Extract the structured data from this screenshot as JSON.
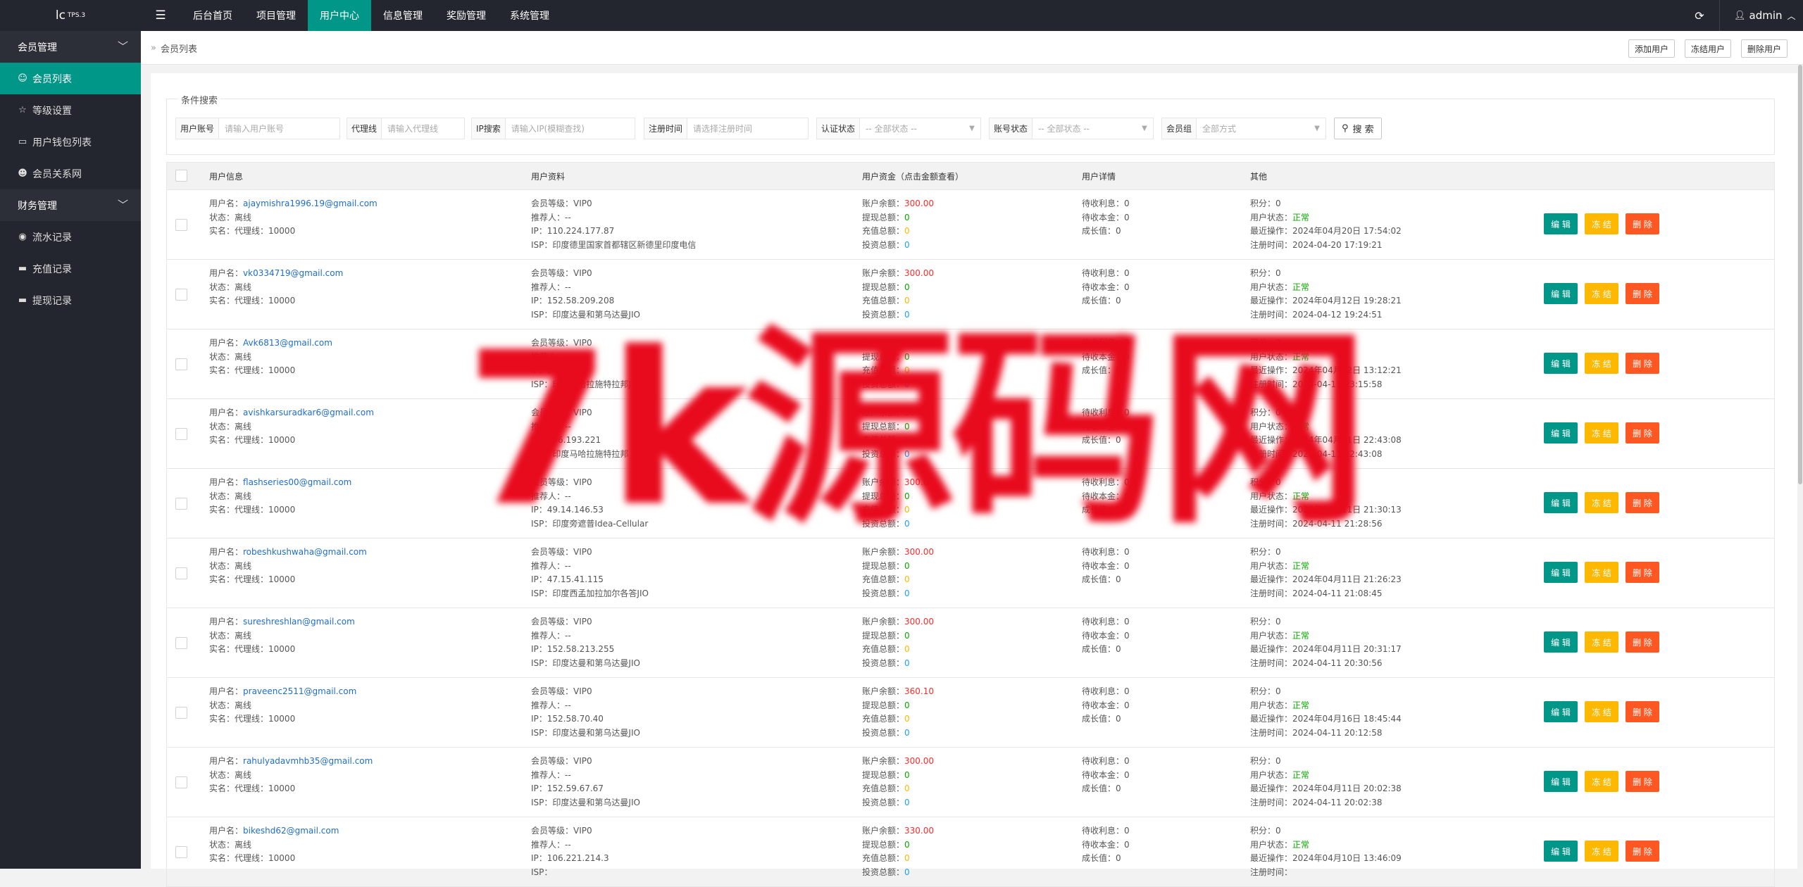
{
  "app": {
    "logo": "lc",
    "version": "TPS.3"
  },
  "top_nav": [
    "后台首页",
    "项目管理",
    "用户中心",
    "信息管理",
    "奖励管理",
    "系统管理"
  ],
  "top_nav_active": "用户中心",
  "user_menu": {
    "name": "admin"
  },
  "sidebar": {
    "groups": [
      {
        "label": "会员管理",
        "items": [
          {
            "label": "会员列表",
            "icon": "user-icon",
            "active": true
          },
          {
            "label": "等级设置",
            "icon": "star-icon"
          },
          {
            "label": "用户钱包列表",
            "icon": "wallet-icon"
          },
          {
            "label": "会员关系网",
            "icon": "users-icon"
          }
        ]
      },
      {
        "label": "财务管理",
        "items": [
          {
            "label": "流水记录",
            "icon": "record-icon"
          },
          {
            "label": "充值记录",
            "icon": "card-icon"
          },
          {
            "label": "提现记录",
            "icon": "card-icon"
          }
        ]
      }
    ]
  },
  "breadcrumb": {
    "separator": "»",
    "current": "会员列表"
  },
  "top_buttons": {
    "add": "添加用户",
    "freeze": "冻结用户",
    "delete": "删除用户"
  },
  "filters": {
    "legend": "条件搜索",
    "account": {
      "label": "用户账号",
      "placeholder": "请输入用户账号"
    },
    "agent": {
      "label": "代理线",
      "placeholder": "请输入代理线"
    },
    "ip": {
      "label": "IP搜索",
      "placeholder": "请输入IP(模糊查找)"
    },
    "regtime": {
      "label": "注册时间",
      "placeholder": "请选择注册时间"
    },
    "auth": {
      "label": "认证状态",
      "value": "-- 全部状态 --"
    },
    "acct_status": {
      "label": "账号状态",
      "value": "-- 全部状态 --"
    },
    "group": {
      "label": "会员组",
      "value": "全部方式"
    },
    "search_button": "搜 索"
  },
  "table": {
    "headers": [
      "用户信息",
      "用户资料",
      "用户资金（点击金额查看）",
      "用户详情",
      "其他"
    ],
    "labels": {
      "username": "用户名：",
      "status": "状态：",
      "realname": "实名：",
      "agent_prefix": "代理线：",
      "level": "会员等级：",
      "referrer": "推荐人：",
      "ip": "IP：",
      "isp": "ISP：",
      "balance": "账户余额：",
      "withdraw": "提现总额：",
      "recharge": "充值总额：",
      "invest": "投资总额：",
      "pending_interest": "待收利息：",
      "pending_principal": "待收本金：",
      "growth": "成长值：",
      "points": "积分：",
      "user_status": "用户状态：",
      "last_op": "最近操作：",
      "reg_time": "注册时间："
    },
    "actions": {
      "edit": "编 辑",
      "freeze": "冻 结",
      "delete": "删 除"
    },
    "rows": [
      {
        "username": "ajaymishra1996.19@gmail.com",
        "status": "离线",
        "agent": "10000",
        "level": "VIP0",
        "referrer": "--",
        "ip": "110.224.177.87",
        "isp": "印度德里国家首都辖区新德里印度电信",
        "balance": "300.00",
        "withdraw": "0",
        "recharge": "0",
        "invest": "0",
        "pending_interest": "0",
        "pending_principal": "0",
        "growth": "0",
        "points": "0",
        "user_status": "正常",
        "last_op": "2024年04月20日 17:54:02",
        "reg_time": "2024-04-20 17:19:21"
      },
      {
        "username": "vk0334719@gmail.com",
        "status": "离线",
        "agent": "10000",
        "level": "VIP0",
        "referrer": "--",
        "ip": "152.58.209.208",
        "isp": "印度达曼和第乌达曼JIO",
        "balance": "300.00",
        "withdraw": "0",
        "recharge": "0",
        "invest": "0",
        "pending_interest": "0",
        "pending_principal": "0",
        "growth": "0",
        "points": "0",
        "user_status": "正常",
        "last_op": "2024年04月12日 19:28:21",
        "reg_time": "2024-04-12 19:24:51"
      },
      {
        "username": "Avk6813@gmail.com",
        "status": "离线",
        "agent": "10000",
        "level": "VIP0",
        "referrer": "--",
        "ip": "249.14",
        "isp": "印度马哈拉施特拉邦JIO",
        "balance": "300.00",
        "withdraw": "0",
        "recharge": "0",
        "invest": "0",
        "pending_interest": "0",
        "pending_principal": "0",
        "growth": "0",
        "points": "0",
        "user_status": "正常",
        "last_op": "2024年04月12日 13:12:21",
        "reg_time": "2024-04-11 23:15:58"
      },
      {
        "username": "avishkarsuradkar6@gmail.com",
        "status": "离线",
        "agent": "10000",
        "level": "VIP0",
        "referrer": "--",
        "ip": "106.193.221",
        "isp": "印度马哈拉施特拉邦",
        "balance": "300.00",
        "withdraw": "0",
        "recharge": "0",
        "invest": "0",
        "pending_interest": "0",
        "pending_principal": "0",
        "growth": "0",
        "points": "0",
        "user_status": "正常",
        "last_op": "2024年04月11日 22:43:08",
        "reg_time": "2024-04-11 22:43:08"
      },
      {
        "username": "flashseries00@gmail.com",
        "status": "离线",
        "agent": "10000",
        "level": "VIP0",
        "referrer": "--",
        "ip": "49.14.146.53",
        "isp": "印度旁遮普Idea-Cellular",
        "balance": "300.00",
        "withdraw": "0",
        "recharge": "0",
        "invest": "0",
        "pending_interest": "0",
        "pending_principal": "0",
        "growth": "0",
        "points": "0",
        "user_status": "正常",
        "last_op": "2024年04月11日 21:30:13",
        "reg_time": "2024-04-11 21:28:56"
      },
      {
        "username": "robeshkushwaha@gmail.com",
        "status": "离线",
        "agent": "10000",
        "level": "VIP0",
        "referrer": "--",
        "ip": "47.15.41.115",
        "isp": "印度西孟加拉加尔各答JIO",
        "balance": "300.00",
        "withdraw": "0",
        "recharge": "0",
        "invest": "0",
        "pending_interest": "0",
        "pending_principal": "0",
        "growth": "0",
        "points": "0",
        "user_status": "正常",
        "last_op": "2024年04月11日 21:26:23",
        "reg_time": "2024-04-11 21:08:45"
      },
      {
        "username": "sureshreshlan@gmail.com",
        "status": "离线",
        "agent": "10000",
        "level": "VIP0",
        "referrer": "--",
        "ip": "152.58.213.255",
        "isp": "印度达曼和第乌达曼JIO",
        "balance": "300.00",
        "withdraw": "0",
        "recharge": "0",
        "invest": "0",
        "pending_interest": "0",
        "pending_principal": "0",
        "growth": "0",
        "points": "0",
        "user_status": "正常",
        "last_op": "2024年04月11日 20:31:17",
        "reg_time": "2024-04-11 20:30:56"
      },
      {
        "username": "praveenc2511@gmail.com",
        "status": "离线",
        "agent": "10000",
        "level": "VIP0",
        "referrer": "--",
        "ip": "152.58.70.40",
        "isp": "印度达曼和第乌达曼JIO",
        "balance": "360.10",
        "withdraw": "0",
        "recharge": "0",
        "invest": "0",
        "pending_interest": "0",
        "pending_principal": "0",
        "growth": "0",
        "points": "0",
        "user_status": "正常",
        "last_op": "2024年04月16日 18:45:44",
        "reg_time": "2024-04-11 20:12:58"
      },
      {
        "username": "rahulyadavmhb35@gmail.com",
        "status": "离线",
        "agent": "10000",
        "level": "VIP0",
        "referrer": "--",
        "ip": "152.59.67.67",
        "isp": "印度达曼和第乌达曼JIO",
        "balance": "300.00",
        "withdraw": "0",
        "recharge": "0",
        "invest": "0",
        "pending_interest": "0",
        "pending_principal": "0",
        "growth": "0",
        "points": "0",
        "user_status": "正常",
        "last_op": "2024年04月11日 20:02:38",
        "reg_time": "2024-04-11 20:02:38"
      },
      {
        "username": "bikeshd62@gmail.com",
        "status": "离线",
        "agent": "10000",
        "level": "VIP0",
        "referrer": "--",
        "ip": "106.221.214.3",
        "isp": "",
        "balance": "330.00",
        "withdraw": "0",
        "recharge": "0",
        "invest": "0",
        "pending_interest": "0",
        "pending_principal": "0",
        "growth": "0",
        "points": "0",
        "user_status": "正常",
        "last_op": "2024年04月10日 13:46:09",
        "reg_time": ""
      }
    ]
  },
  "watermark": "7k源码网",
  "colors": {
    "accent": "#009688",
    "topbar": "#23262e",
    "freeze": "#ffb800",
    "delete": "#ff5722",
    "link": "#1e6dc8",
    "balance": "#ff2a2a",
    "ok": "#09a800"
  }
}
